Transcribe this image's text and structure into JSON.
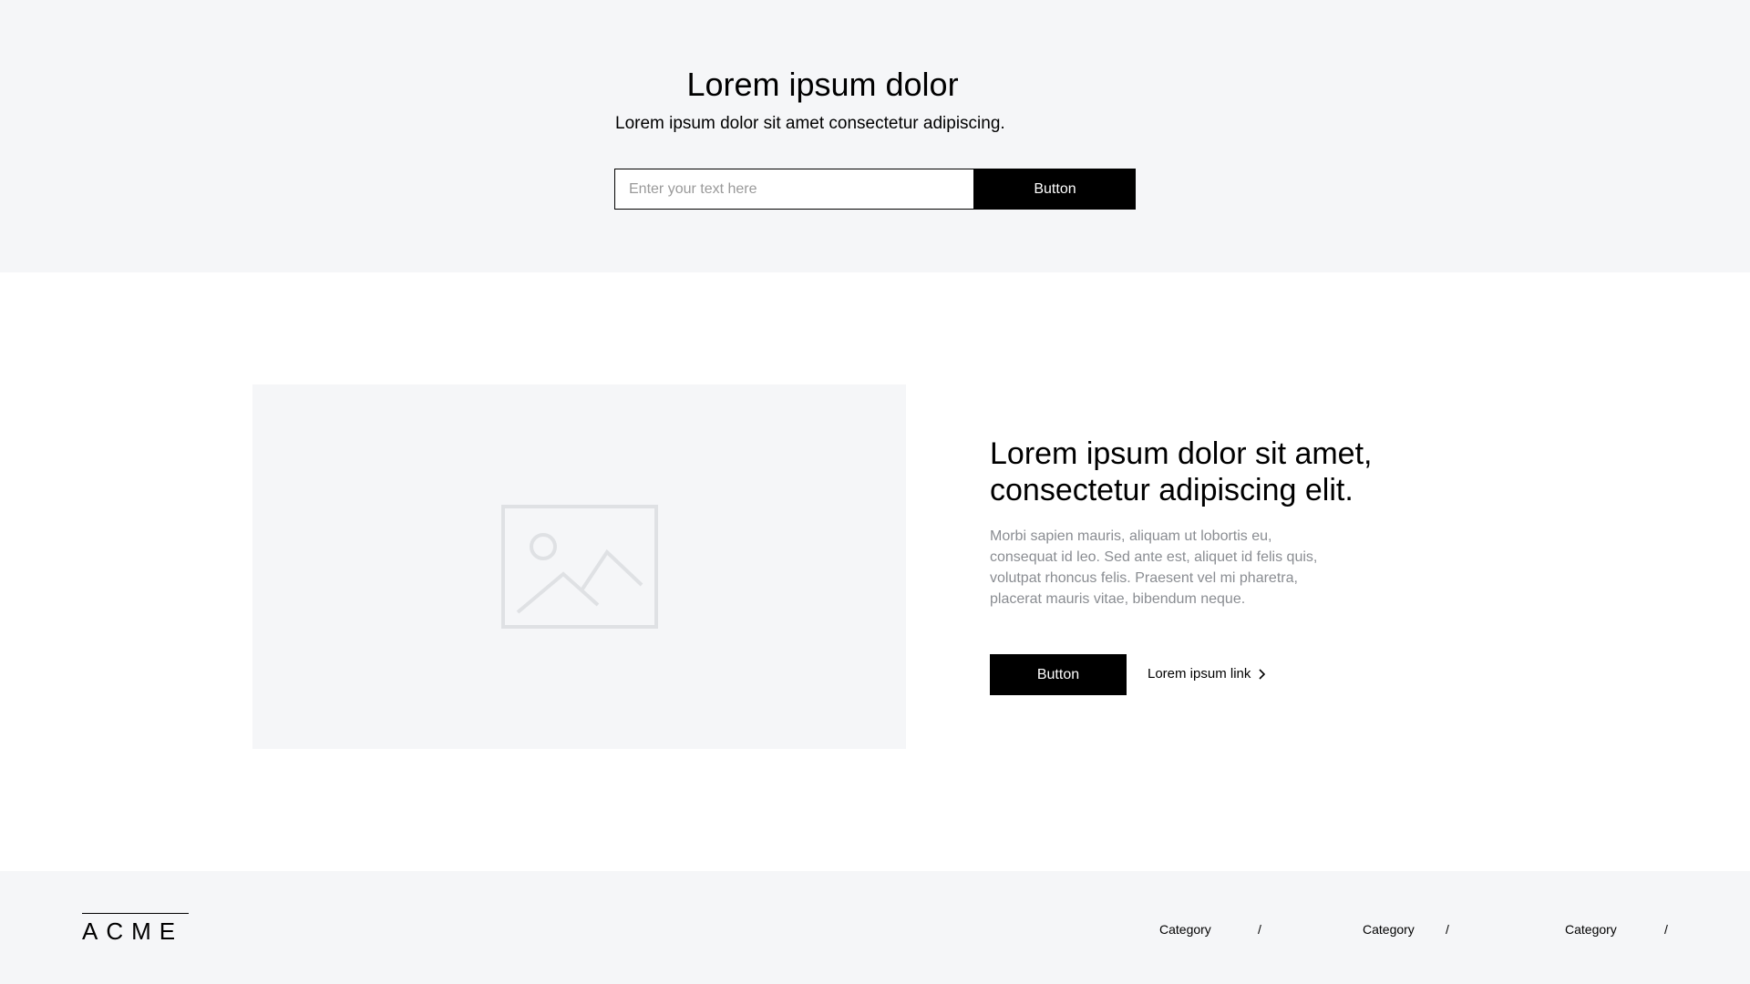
{
  "hero": {
    "title": "Lorem ipsum dolor",
    "subtitle": "Lorem ipsum dolor sit amet consectetur adipiscing.",
    "input_placeholder": "Enter your text here",
    "button_label": "Button"
  },
  "feature": {
    "image_icon": "image-placeholder-icon",
    "title": "Lorem ipsum dolor sit amet, consectetur adipiscing elit.",
    "body": "Morbi sapien mauris, aliquam ut lobortis eu, consequat id leo. Sed ante est, aliquet id felis quis, volutpat rhoncus felis. Praesent vel mi pharetra, placerat mauris vitae, bibendum neque.",
    "button_label": "Button",
    "link_label": "Lorem ipsum link",
    "link_icon": "chevron-right-icon"
  },
  "footer": {
    "logo": "ACME",
    "nav": [
      {
        "label": "Category"
      },
      {
        "label": "Category"
      },
      {
        "label": "Category"
      }
    ],
    "separator": "/"
  },
  "colors": {
    "section_bg": "#f5f6f8",
    "button_bg": "#000000",
    "button_text": "#ffffff",
    "body_text_muted": "#8a8d92"
  }
}
